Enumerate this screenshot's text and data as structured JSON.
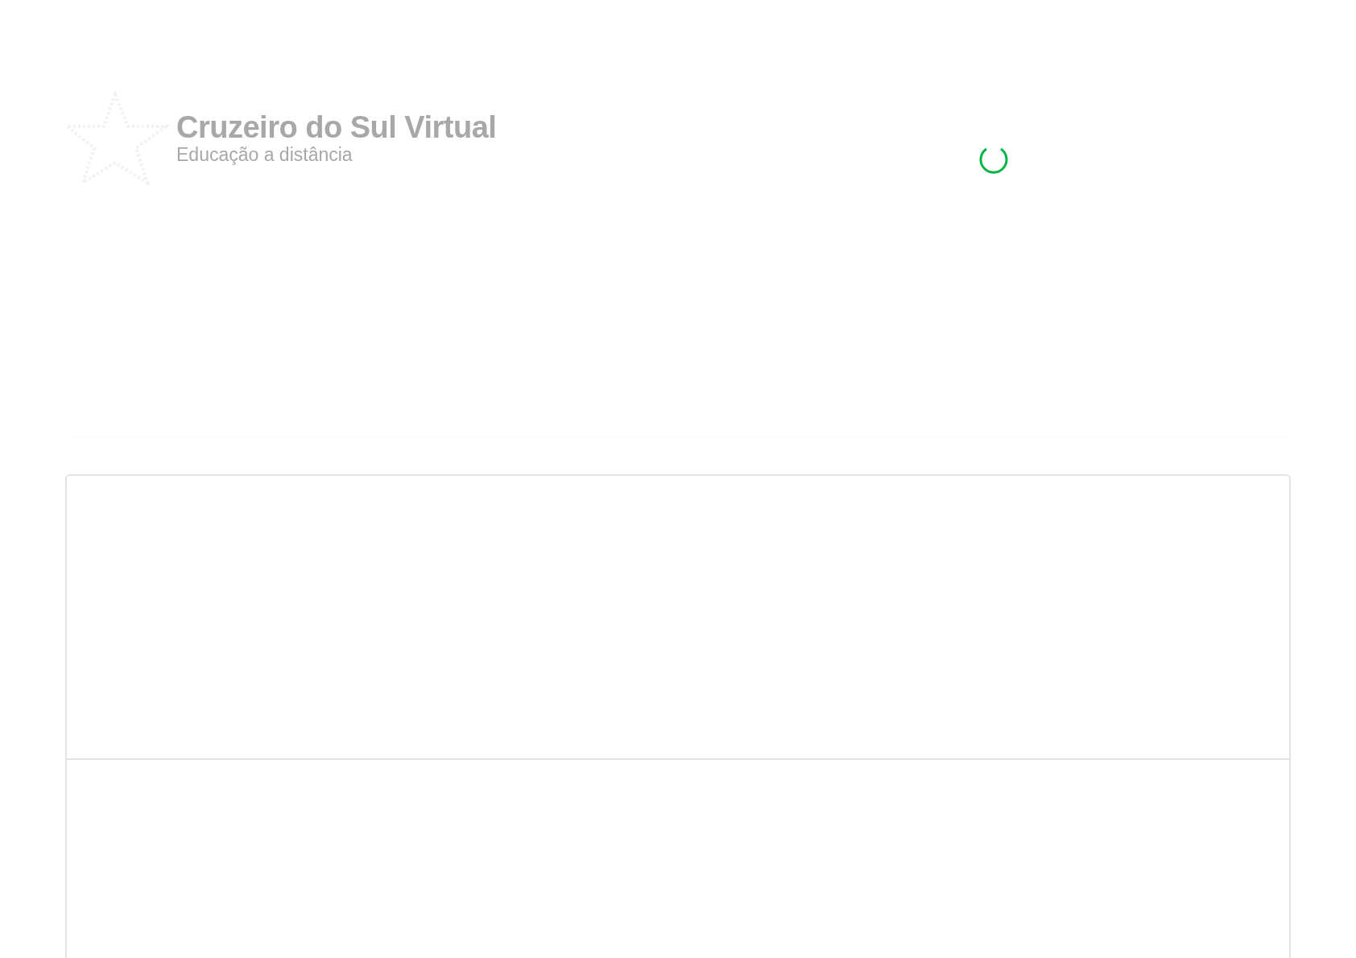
{
  "header": {
    "logo_title": "Cruzeiro do Sul Virtual",
    "logo_subtitle": "Educação a distância"
  }
}
